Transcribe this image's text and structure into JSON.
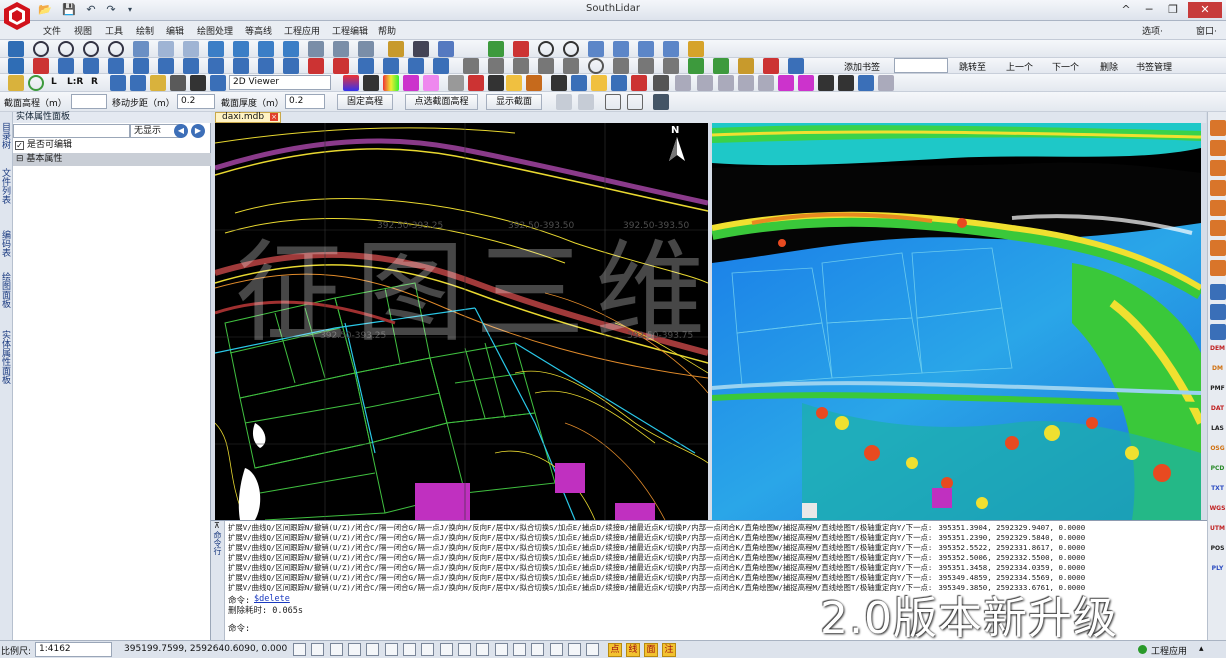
{
  "app": {
    "title": "SouthLidar"
  },
  "window": {
    "options_label": "选项·",
    "window_label": "窗口·"
  },
  "menubar": {
    "items": [
      "文件",
      "视图",
      "工具",
      "绘制",
      "编辑",
      "绘图处理",
      "等高线",
      "工程应用",
      "工程编辑",
      "帮助"
    ]
  },
  "bookmarks": {
    "add": "添加书签",
    "jump": "跳转至",
    "prev": "上一个",
    "next": "下一个",
    "delete": "删除",
    "manage": "书签管理"
  },
  "viewer": {
    "mode": "2D Viewer",
    "lr_label": "L:R",
    "l_label": "L",
    "r_label": "R"
  },
  "section_toolbar": {
    "height_label": "截面高程（m）",
    "step_label": "移动步距（m）",
    "step_value": "0.2",
    "thickness_label": "截面厚度（m）",
    "thickness_value": "0.2",
    "fixed_height": "固定高程",
    "pick_height": "点选截面高程",
    "show_section": "显示截面"
  },
  "left_rail": {
    "tabs": [
      "目录树",
      "文件列表",
      "编码表",
      "绘图面板",
      "实体属性面板"
    ]
  },
  "panel": {
    "title": "实体属性面板",
    "display_option": "无显示",
    "editable_label": "是否可编辑",
    "editable_checked": "✓",
    "basic_props": "基本属性"
  },
  "document": {
    "tab_label": "daxi.mdb"
  },
  "cad_view": {
    "north": "N",
    "contour_labels": [
      "392.50-393.25",
      "392.50-393.50",
      "392.50-393.50",
      "392.50-393.75",
      "392.50-393.25"
    ],
    "watermark": "征图三维"
  },
  "right_toolbar": {
    "formats": [
      "DEM",
      "DM",
      "PMF",
      "DAT",
      "LAS",
      "OSG",
      "PCD",
      "TXT",
      "WGS",
      "UTM",
      "POS",
      "PLY"
    ]
  },
  "command": {
    "side_label": "命令行",
    "log": [
      {
        "prompt": "扩展V/曲线Q/区间跟踪N/撤销(U/Z)/闭合C/隔一闭合G/隔一点J/换向H/反向F/居中X/拟合切换S/加点E/捕点D/续接B/捕最近点K/切换P/内部一点闭合K/直角绘图W/捕捉高程M/直线绘图T/极轴重定向Y/下一点:",
        "coords": "395351.3904, 2592329.9407, 0.0000"
      },
      {
        "prompt": "扩展V/曲线Q/区间跟踪N/撤销(U/Z)/闭合C/隔一闭合G/隔一点J/换向H/反向F/居中X/拟合切换S/加点E/捕点D/续接B/捕最近点K/切换P/内部一点闭合K/直角绘图W/捕捉高程M/直线绘图T/极轴重定向Y/下一点:",
        "coords": "395351.2390, 2592329.5840, 0.0000"
      },
      {
        "prompt": "扩展V/曲线Q/区间跟踪N/撤销(U/Z)/闭合C/隔一闭合G/隔一点J/换向H/反向F/居中X/拟合切换S/加点E/捕点D/续接B/捕最近点K/切换P/内部一点闭合K/直角绘图W/捕捉高程M/直线绘图T/极轴重定向Y/下一点:",
        "coords": "395352.5522, 2592331.8617, 0.0000"
      },
      {
        "prompt": "扩展V/曲线Q/区间跟踪N/撤销(U/Z)/闭合C/隔一闭合G/隔一点J/换向H/反向F/居中X/拟合切换S/加点E/捕点D/续接B/捕最近点K/切换P/内部一点闭合K/直角绘图W/捕捉高程M/直线绘图T/极轴重定向Y/下一点:",
        "coords": "395352.5006, 2592332.5500, 0.0000"
      },
      {
        "prompt": "扩展V/曲线Q/区间跟踪N/撤销(U/Z)/闭合C/隔一闭合G/隔一点J/换向H/反向F/居中X/拟合切换S/加点E/捕点D/续接B/捕最近点K/切换P/内部一点闭合K/直角绘图W/捕捉高程M/直线绘图T/极轴重定向Y/下一点:",
        "coords": "395351.3458, 2592334.0359, 0.0000"
      },
      {
        "prompt": "扩展V/曲线Q/区间跟踪N/撤销(U/Z)/闭合C/隔一闭合G/隔一点J/换向H/反向F/居中X/拟合切换S/加点E/捕点D/续接B/捕最近点K/切换P/内部一点闭合K/直角绘图W/捕捉高程M/直线绘图T/极轴重定向Y/下一点:",
        "coords": "395349.4859, 2592334.5569, 0.0000"
      },
      {
        "prompt": "扩展V/曲线Q/区间跟踪N/撤销(U/Z)/闭合C/隔一闭合G/隔一点J/换向H/反向F/居中X/拟合切换S/加点E/捕点D/续接B/捕最近点K/切换P/内部一点闭合K/直角绘图W/捕捉高程M/直线绘图T/极轴重定向Y/下一点:",
        "coords": "395349.3850, 2592333.6761, 0.0000"
      }
    ],
    "cmd_prefix": "命令:",
    "cmd_name": "$delete",
    "elapsed": "删除耗时: 0.065s",
    "prompt": "命令:"
  },
  "statusbar": {
    "scale_label": "比例尺:",
    "scale_value": "1:4162",
    "coords": "395199.7599, 2592640.6090, 0.000",
    "snap_point": "点",
    "snap_line": "线",
    "snap_face": "面",
    "snap_note": "注",
    "project_app": "工程应用"
  },
  "overlay": {
    "banner": "2.0版本新升级"
  },
  "colors": {
    "titlebar_accent": "#c8141e",
    "cad_background": "#000000",
    "osnap_yellow": "#f2c230"
  }
}
